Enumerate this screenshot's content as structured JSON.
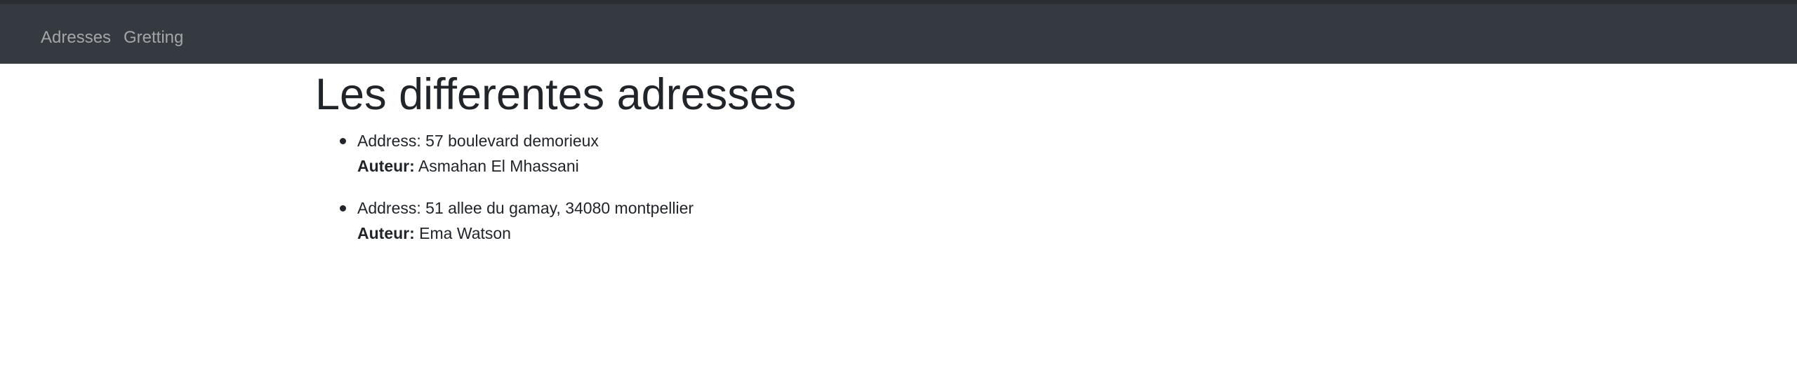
{
  "nav": {
    "items": [
      {
        "label": "Adresses"
      },
      {
        "label": "Gretting"
      }
    ]
  },
  "main": {
    "title": "Les differentes adresses",
    "addresses": [
      {
        "address_label": "Address:",
        "address": "57 boulevard demorieux",
        "author_label": "Auteur:",
        "author": "Asmahan El Mhassani"
      },
      {
        "address_label": "Address:",
        "address": "51 allee du gamay, 34080 montpellier",
        "author_label": "Auteur:",
        "author": "Ema Watson"
      }
    ]
  },
  "colors": {
    "navbar_bg": "#343a40",
    "nav_link": "#9a9da0",
    "text": "#212529"
  }
}
